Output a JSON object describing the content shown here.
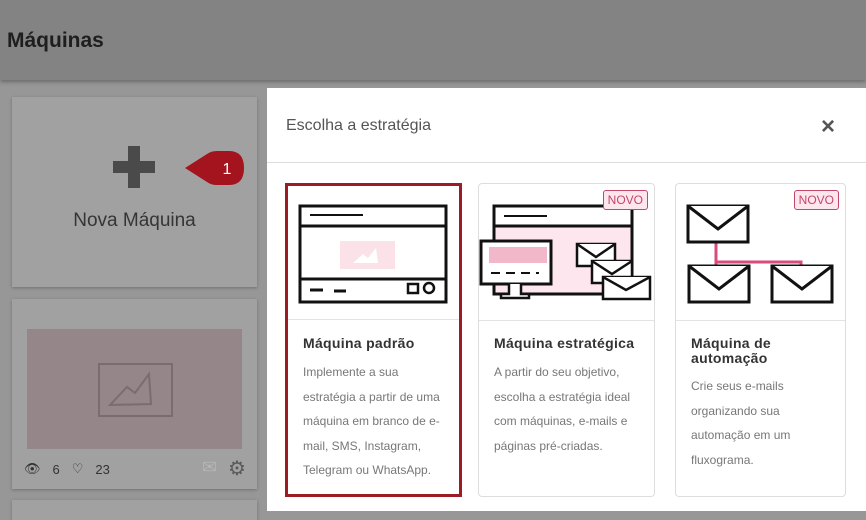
{
  "page": {
    "title": "Máquinas"
  },
  "new_machine": {
    "label": "Nova Máquina",
    "step_badge": "1"
  },
  "machine_card": {
    "views": "6",
    "likes": "23"
  },
  "modal": {
    "title": "Escolha a estratégia",
    "close": "×",
    "options": [
      {
        "title": "Máquina padrão",
        "desc": "Implemente a sua estratégia a partir de uma máquina em branco de e-mail, SMS, Instagram, Telegram ou WhatsApp.",
        "selected": true
      },
      {
        "title": "Máquina estratégica",
        "desc": "A partir do seu objetivo, escolha a estratégia ideal com máquinas, e-mails e páginas pré-criadas.",
        "badge": "NOVO"
      },
      {
        "title": "Máquina de automação",
        "desc": "Crie seus e-mails organizando sua automação em um fluxograma.",
        "badge": "NOVO"
      }
    ]
  },
  "colors": {
    "selected_border": "#9b1c24",
    "badge": "#c2476b"
  }
}
